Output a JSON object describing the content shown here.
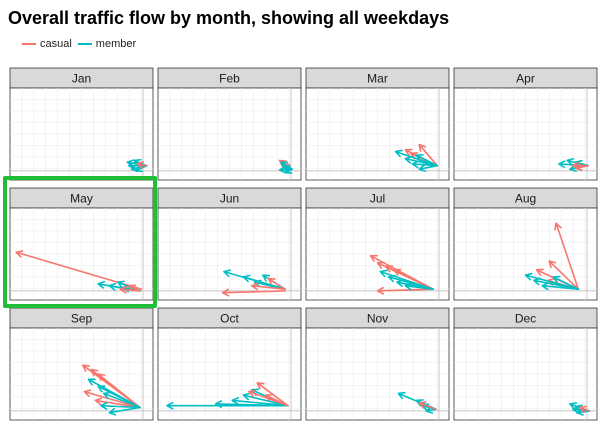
{
  "title": "Overall traffic flow by month, showing all weekdays",
  "colors": {
    "casual": "#F8766D",
    "member": "#00BFC4",
    "highlight": "#1FBF35"
  },
  "chart_data": {
    "type": "vector-field (arrows), small multiples",
    "title": "Overall traffic flow by month, showing all weekdays",
    "legend": {
      "position": "top-left",
      "entries": [
        "casual",
        "member"
      ]
    },
    "grid": true,
    "xlim": [
      0,
      1
    ],
    "ylim": [
      0,
      1
    ],
    "highlighted_panel": "May",
    "panels": [
      {
        "month": "Jan",
        "arrows": [
          {
            "s": "member",
            "x0": 0.97,
            "y0": 0.14,
            "x1": 0.83,
            "y1": 0.18
          },
          {
            "s": "member",
            "x0": 0.97,
            "y0": 0.14,
            "x1": 0.84,
            "y1": 0.14
          },
          {
            "s": "member",
            "x0": 0.97,
            "y0": 0.14,
            "x1": 0.86,
            "y1": 0.1
          },
          {
            "s": "member",
            "x0": 0.97,
            "y0": 0.14,
            "x1": 0.88,
            "y1": 0.2
          },
          {
            "s": "member",
            "x0": 0.97,
            "y0": 0.14,
            "x1": 0.89,
            "y1": 0.08
          },
          {
            "s": "casual",
            "x0": 0.97,
            "y0": 0.14,
            "x1": 0.9,
            "y1": 0.16
          }
        ]
      },
      {
        "month": "Feb",
        "arrows": [
          {
            "s": "casual",
            "x0": 0.95,
            "y0": 0.1,
            "x1": 0.86,
            "y1": 0.2
          },
          {
            "s": "casual",
            "x0": 0.95,
            "y0": 0.1,
            "x1": 0.88,
            "y1": 0.15
          },
          {
            "s": "member",
            "x0": 0.95,
            "y0": 0.1,
            "x1": 0.87,
            "y1": 0.18
          },
          {
            "s": "member",
            "x0": 0.95,
            "y0": 0.1,
            "x1": 0.89,
            "y1": 0.12
          },
          {
            "s": "member",
            "x0": 0.95,
            "y0": 0.1,
            "x1": 0.9,
            "y1": 0.06
          },
          {
            "s": "member",
            "x0": 0.95,
            "y0": 0.1,
            "x1": 0.86,
            "y1": 0.09
          }
        ]
      },
      {
        "month": "Mar",
        "arrows": [
          {
            "s": "casual",
            "x0": 0.93,
            "y0": 0.14,
            "x1": 0.8,
            "y1": 0.38
          },
          {
            "s": "casual",
            "x0": 0.93,
            "y0": 0.14,
            "x1": 0.7,
            "y1": 0.32
          },
          {
            "s": "casual",
            "x0": 0.93,
            "y0": 0.14,
            "x1": 0.74,
            "y1": 0.28
          },
          {
            "s": "member",
            "x0": 0.93,
            "y0": 0.14,
            "x1": 0.63,
            "y1": 0.3
          },
          {
            "s": "member",
            "x0": 0.93,
            "y0": 0.14,
            "x1": 0.7,
            "y1": 0.22
          },
          {
            "s": "member",
            "x0": 0.93,
            "y0": 0.14,
            "x1": 0.75,
            "y1": 0.16
          },
          {
            "s": "member",
            "x0": 0.93,
            "y0": 0.14,
            "x1": 0.78,
            "y1": 0.26
          },
          {
            "s": "member",
            "x0": 0.93,
            "y0": 0.14,
            "x1": 0.8,
            "y1": 0.1
          }
        ]
      },
      {
        "month": "Apr",
        "arrows": [
          {
            "s": "member",
            "x0": 0.95,
            "y0": 0.14,
            "x1": 0.74,
            "y1": 0.16
          },
          {
            "s": "member",
            "x0": 0.95,
            "y0": 0.14,
            "x1": 0.8,
            "y1": 0.2
          },
          {
            "s": "member",
            "x0": 0.95,
            "y0": 0.14,
            "x1": 0.82,
            "y1": 0.1
          },
          {
            "s": "member",
            "x0": 0.95,
            "y0": 0.14,
            "x1": 0.86,
            "y1": 0.18
          },
          {
            "s": "casual",
            "x0": 0.95,
            "y0": 0.14,
            "x1": 0.84,
            "y1": 0.14
          },
          {
            "s": "casual",
            "x0": 0.95,
            "y0": 0.14,
            "x1": 0.86,
            "y1": 0.11
          }
        ]
      },
      {
        "month": "May",
        "arrows": [
          {
            "s": "casual",
            "x0": 0.93,
            "y0": 0.1,
            "x1": 0.03,
            "y1": 0.52
          },
          {
            "s": "member",
            "x0": 0.92,
            "y0": 0.08,
            "x1": 0.62,
            "y1": 0.16
          },
          {
            "s": "member",
            "x0": 0.92,
            "y0": 0.08,
            "x1": 0.7,
            "y1": 0.14
          },
          {
            "s": "member",
            "x0": 0.92,
            "y0": 0.08,
            "x1": 0.76,
            "y1": 0.18
          },
          {
            "s": "member",
            "x0": 0.92,
            "y0": 0.08,
            "x1": 0.8,
            "y1": 0.12
          },
          {
            "s": "casual",
            "x0": 0.92,
            "y0": 0.08,
            "x1": 0.78,
            "y1": 0.1
          },
          {
            "s": "casual",
            "x0": 0.92,
            "y0": 0.08,
            "x1": 0.84,
            "y1": 0.14
          }
        ]
      },
      {
        "month": "Jun",
        "arrows": [
          {
            "s": "casual",
            "x0": 0.9,
            "y0": 0.08,
            "x1": 0.45,
            "y1": 0.06
          },
          {
            "s": "member",
            "x0": 0.9,
            "y0": 0.1,
            "x1": 0.46,
            "y1": 0.3
          },
          {
            "s": "member",
            "x0": 0.9,
            "y0": 0.1,
            "x1": 0.6,
            "y1": 0.24
          },
          {
            "s": "member",
            "x0": 0.9,
            "y0": 0.1,
            "x1": 0.68,
            "y1": 0.18
          },
          {
            "s": "member",
            "x0": 0.9,
            "y0": 0.1,
            "x1": 0.74,
            "y1": 0.26
          },
          {
            "s": "casual",
            "x0": 0.9,
            "y0": 0.1,
            "x1": 0.66,
            "y1": 0.14
          },
          {
            "s": "casual",
            "x0": 0.9,
            "y0": 0.1,
            "x1": 0.78,
            "y1": 0.22
          }
        ]
      },
      {
        "month": "Jul",
        "arrows": [
          {
            "s": "casual",
            "x0": 0.9,
            "y0": 0.1,
            "x1": 0.45,
            "y1": 0.48
          },
          {
            "s": "casual",
            "x0": 0.9,
            "y0": 0.1,
            "x1": 0.5,
            "y1": 0.4
          },
          {
            "s": "casual",
            "x0": 0.9,
            "y0": 0.1,
            "x1": 0.56,
            "y1": 0.36
          },
          {
            "s": "casual",
            "x0": 0.9,
            "y0": 0.1,
            "x1": 0.62,
            "y1": 0.32
          },
          {
            "s": "casual",
            "x0": 0.9,
            "y0": 0.1,
            "x1": 0.5,
            "y1": 0.08
          },
          {
            "s": "member",
            "x0": 0.9,
            "y0": 0.1,
            "x1": 0.52,
            "y1": 0.3
          },
          {
            "s": "member",
            "x0": 0.9,
            "y0": 0.1,
            "x1": 0.58,
            "y1": 0.24
          },
          {
            "s": "member",
            "x0": 0.9,
            "y0": 0.1,
            "x1": 0.64,
            "y1": 0.18
          },
          {
            "s": "member",
            "x0": 0.9,
            "y0": 0.1,
            "x1": 0.7,
            "y1": 0.14
          }
        ]
      },
      {
        "month": "Aug",
        "arrows": [
          {
            "s": "casual",
            "x0": 0.88,
            "y0": 0.1,
            "x1": 0.72,
            "y1": 0.85
          },
          {
            "s": "casual",
            "x0": 0.88,
            "y0": 0.1,
            "x1": 0.67,
            "y1": 0.42
          },
          {
            "s": "casual",
            "x0": 0.88,
            "y0": 0.1,
            "x1": 0.58,
            "y1": 0.32
          },
          {
            "s": "casual",
            "x0": 0.88,
            "y0": 0.1,
            "x1": 0.66,
            "y1": 0.2
          },
          {
            "s": "member",
            "x0": 0.88,
            "y0": 0.1,
            "x1": 0.5,
            "y1": 0.26
          },
          {
            "s": "member",
            "x0": 0.88,
            "y0": 0.1,
            "x1": 0.56,
            "y1": 0.2
          },
          {
            "s": "member",
            "x0": 0.88,
            "y0": 0.1,
            "x1": 0.62,
            "y1": 0.14
          },
          {
            "s": "member",
            "x0": 0.88,
            "y0": 0.1,
            "x1": 0.7,
            "y1": 0.24
          }
        ]
      },
      {
        "month": "Sep",
        "arrows": [
          {
            "s": "casual",
            "x0": 0.92,
            "y0": 0.12,
            "x1": 0.51,
            "y1": 0.6
          },
          {
            "s": "casual",
            "x0": 0.92,
            "y0": 0.12,
            "x1": 0.57,
            "y1": 0.55
          },
          {
            "s": "casual",
            "x0": 0.92,
            "y0": 0.12,
            "x1": 0.62,
            "y1": 0.5
          },
          {
            "s": "casual",
            "x0": 0.92,
            "y0": 0.12,
            "x1": 0.52,
            "y1": 0.3
          },
          {
            "s": "casual",
            "x0": 0.92,
            "y0": 0.12,
            "x1": 0.6,
            "y1": 0.2
          },
          {
            "s": "member",
            "x0": 0.92,
            "y0": 0.12,
            "x1": 0.55,
            "y1": 0.44
          },
          {
            "s": "member",
            "x0": 0.92,
            "y0": 0.12,
            "x1": 0.62,
            "y1": 0.36
          },
          {
            "s": "member",
            "x0": 0.92,
            "y0": 0.12,
            "x1": 0.66,
            "y1": 0.28
          },
          {
            "s": "member",
            "x0": 0.92,
            "y0": 0.12,
            "x1": 0.64,
            "y1": 0.14
          },
          {
            "s": "member",
            "x0": 0.92,
            "y0": 0.12,
            "x1": 0.7,
            "y1": 0.06
          }
        ]
      },
      {
        "month": "Oct",
        "arrows": [
          {
            "s": "member",
            "x0": 0.92,
            "y0": 0.14,
            "x1": 0.4,
            "y1": 0.16
          },
          {
            "s": "member",
            "x0": 0.92,
            "y0": 0.14,
            "x1": 0.05,
            "y1": 0.14
          },
          {
            "s": "member",
            "x0": 0.92,
            "y0": 0.14,
            "x1": 0.52,
            "y1": 0.2
          },
          {
            "s": "member",
            "x0": 0.92,
            "y0": 0.14,
            "x1": 0.6,
            "y1": 0.26
          },
          {
            "s": "member",
            "x0": 0.92,
            "y0": 0.14,
            "x1": 0.66,
            "y1": 0.32
          },
          {
            "s": "casual",
            "x0": 0.92,
            "y0": 0.14,
            "x1": 0.7,
            "y1": 0.4
          },
          {
            "s": "casual",
            "x0": 0.92,
            "y0": 0.14,
            "x1": 0.64,
            "y1": 0.3
          },
          {
            "s": "casual",
            "x0": 0.92,
            "y0": 0.14,
            "x1": 0.76,
            "y1": 0.26
          }
        ]
      },
      {
        "month": "Nov",
        "arrows": [
          {
            "s": "member",
            "x0": 0.92,
            "y0": 0.1,
            "x1": 0.65,
            "y1": 0.28
          },
          {
            "s": "member",
            "x0": 0.92,
            "y0": 0.1,
            "x1": 0.78,
            "y1": 0.2
          },
          {
            "s": "member",
            "x0": 0.92,
            "y0": 0.1,
            "x1": 0.82,
            "y1": 0.14
          },
          {
            "s": "member",
            "x0": 0.92,
            "y0": 0.1,
            "x1": 0.85,
            "y1": 0.08
          },
          {
            "s": "casual",
            "x0": 0.92,
            "y0": 0.1,
            "x1": 0.8,
            "y1": 0.17
          }
        ]
      },
      {
        "month": "Dec",
        "arrows": [
          {
            "s": "member",
            "x0": 0.96,
            "y0": 0.08,
            "x1": 0.82,
            "y1": 0.16
          },
          {
            "s": "member",
            "x0": 0.96,
            "y0": 0.08,
            "x1": 0.84,
            "y1": 0.1
          },
          {
            "s": "member",
            "x0": 0.96,
            "y0": 0.08,
            "x1": 0.87,
            "y1": 0.06
          },
          {
            "s": "member",
            "x0": 0.96,
            "y0": 0.08,
            "x1": 0.86,
            "y1": 0.13
          },
          {
            "s": "casual",
            "x0": 0.96,
            "y0": 0.08,
            "x1": 0.89,
            "y1": 0.12
          }
        ]
      }
    ]
  }
}
